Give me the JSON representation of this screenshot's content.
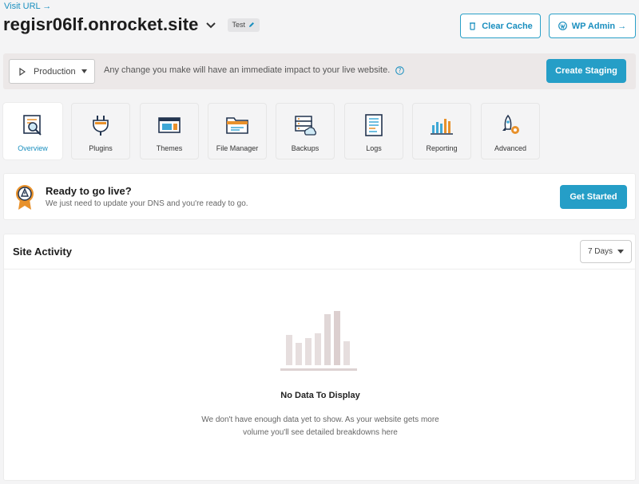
{
  "header": {
    "visit_url": "Visit URL →",
    "site_name": "regisr06lf.onrocket.site",
    "env_badge": "Test",
    "clear_cache": "Clear Cache",
    "wp_admin": "WP Admin →"
  },
  "production_bar": {
    "selected_env": "Production",
    "message": "Any change you make will have an immediate impact to your live website.",
    "create_staging": "Create Staging"
  },
  "tools": [
    {
      "label": "Overview",
      "icon": "overview-icon",
      "active": true
    },
    {
      "label": "Plugins",
      "icon": "plugin-icon",
      "active": false
    },
    {
      "label": "Themes",
      "icon": "themes-icon",
      "active": false
    },
    {
      "label": "File Manager",
      "icon": "folder-icon",
      "active": false
    },
    {
      "label": "Backups",
      "icon": "backups-icon",
      "active": false
    },
    {
      "label": "Logs",
      "icon": "logs-icon",
      "active": false
    },
    {
      "label": "Reporting",
      "icon": "reporting-icon",
      "active": false
    },
    {
      "label": "Advanced",
      "icon": "rocket-gear-icon",
      "active": false
    }
  ],
  "go_live": {
    "title": "Ready to go live?",
    "subtitle": "We just need to update your DNS and you're ready to go.",
    "button": "Get Started"
  },
  "activity": {
    "title": "Site Activity",
    "range": "7 Days",
    "empty_title": "No Data To Display",
    "empty_line1": "We don't have enough data yet to show. As your website gets more",
    "empty_line2": "volume you'll see detailed breakdowns here"
  },
  "colors": {
    "accent": "#259ec7",
    "link": "#1a8fbf",
    "orange": "#e8912b",
    "navy": "#22344f"
  }
}
